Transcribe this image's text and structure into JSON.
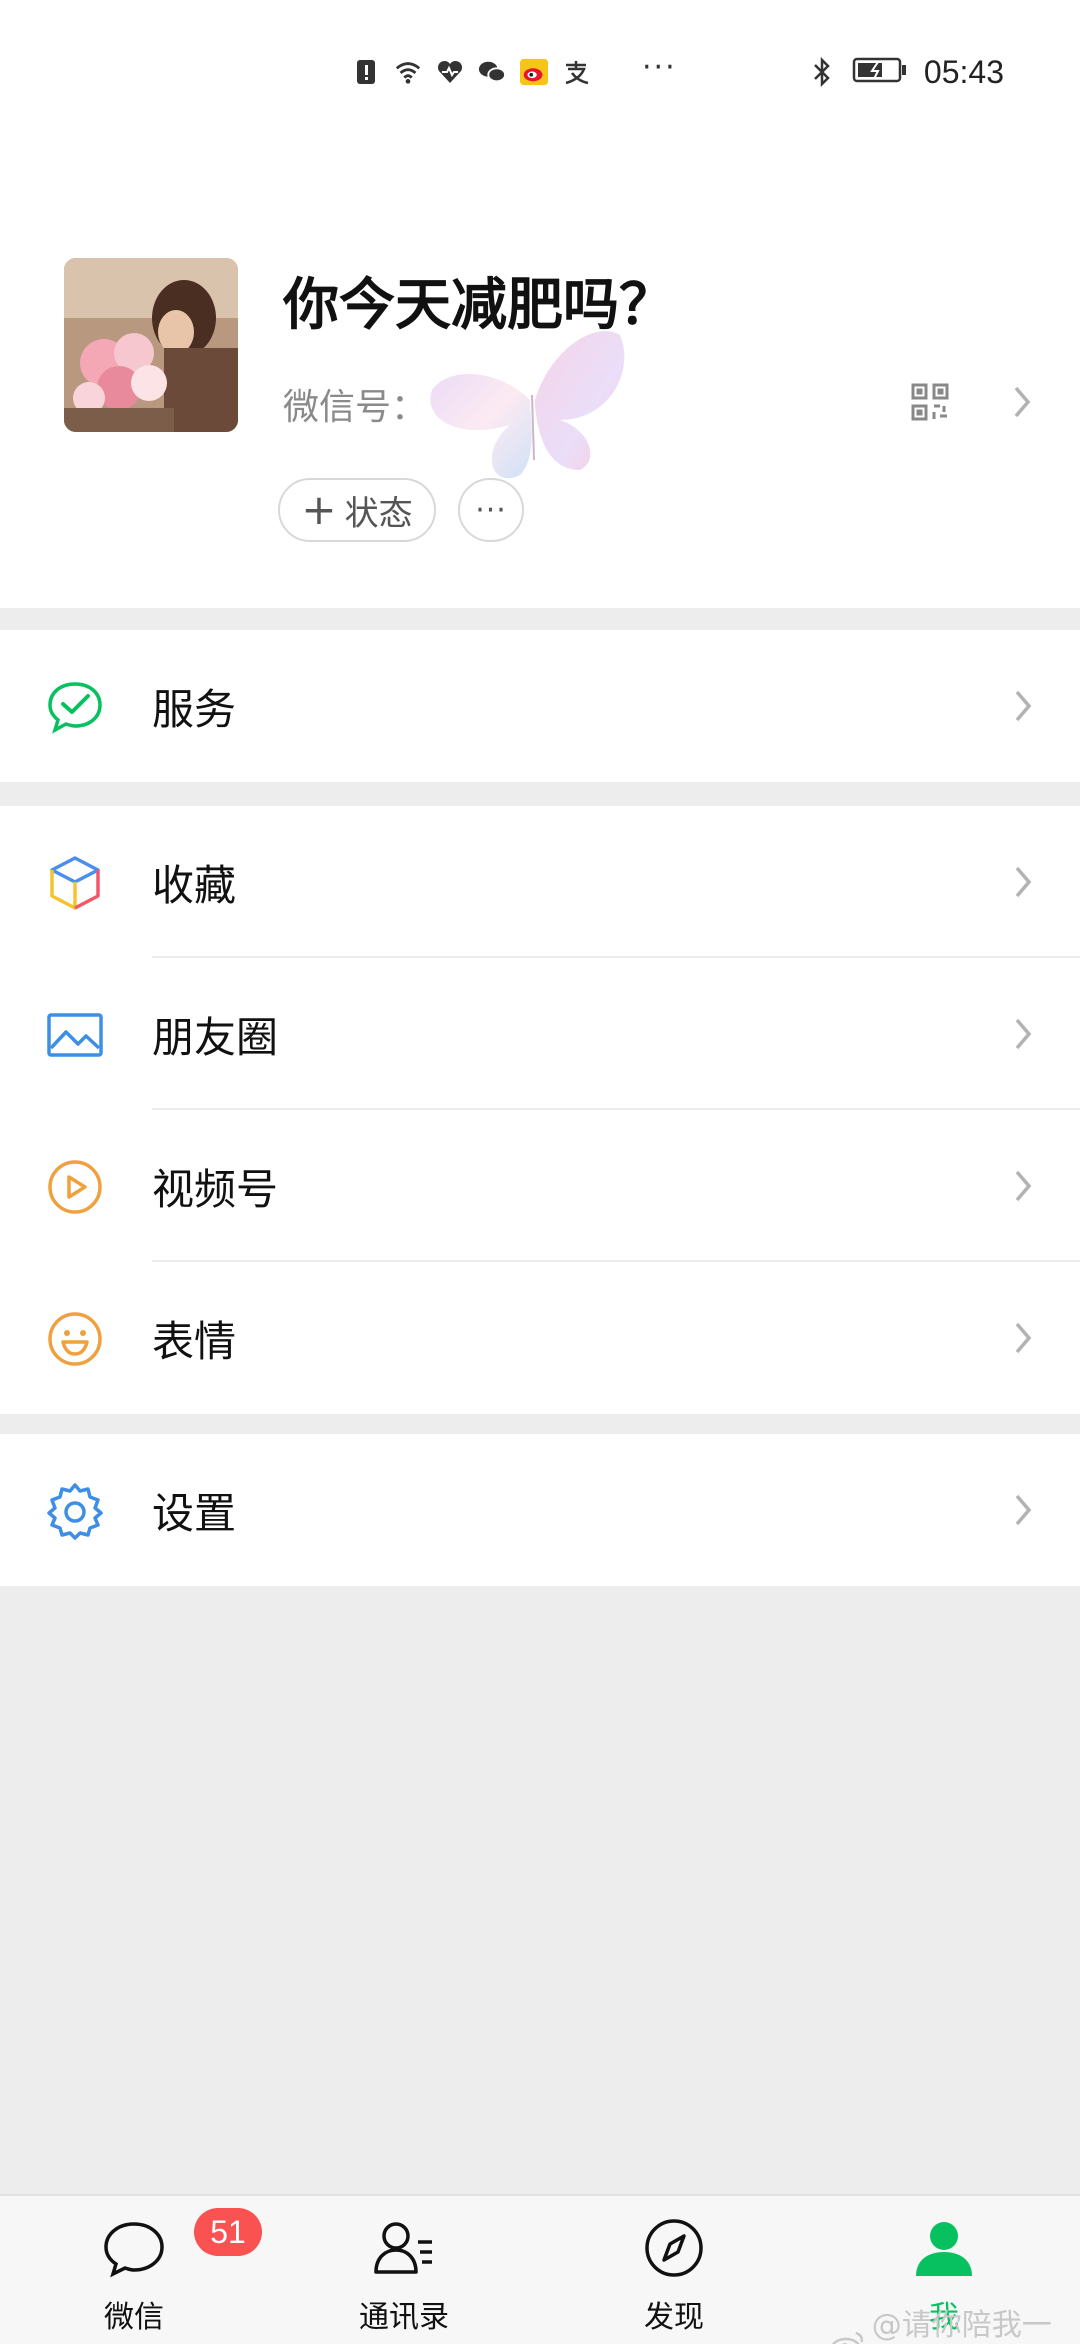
{
  "status_bar": {
    "time": "05:43",
    "notification_icons": [
      "alert-icon",
      "wifi-icon",
      "health-icon",
      "wechat-icon",
      "weibo-icon",
      "alipay-icon"
    ],
    "more": "···"
  },
  "profile": {
    "name": "你今天减肥吗？",
    "wechat_id_label": "微信号：",
    "status_button": "状态",
    "more_button": "···"
  },
  "menu": {
    "services": "服务",
    "favorites": "收藏",
    "moments": "朋友圈",
    "channels": "视频号",
    "stickers": "表情",
    "settings": "设置"
  },
  "tabbar": {
    "chats": "微信",
    "chats_badge": "51",
    "contacts": "通讯录",
    "discover": "发现",
    "me": "我"
  },
  "watermark": "@请你陪我一下",
  "colors": {
    "accent_green": "#07c160",
    "badge_red": "#fa5151",
    "background": "#ededed"
  }
}
